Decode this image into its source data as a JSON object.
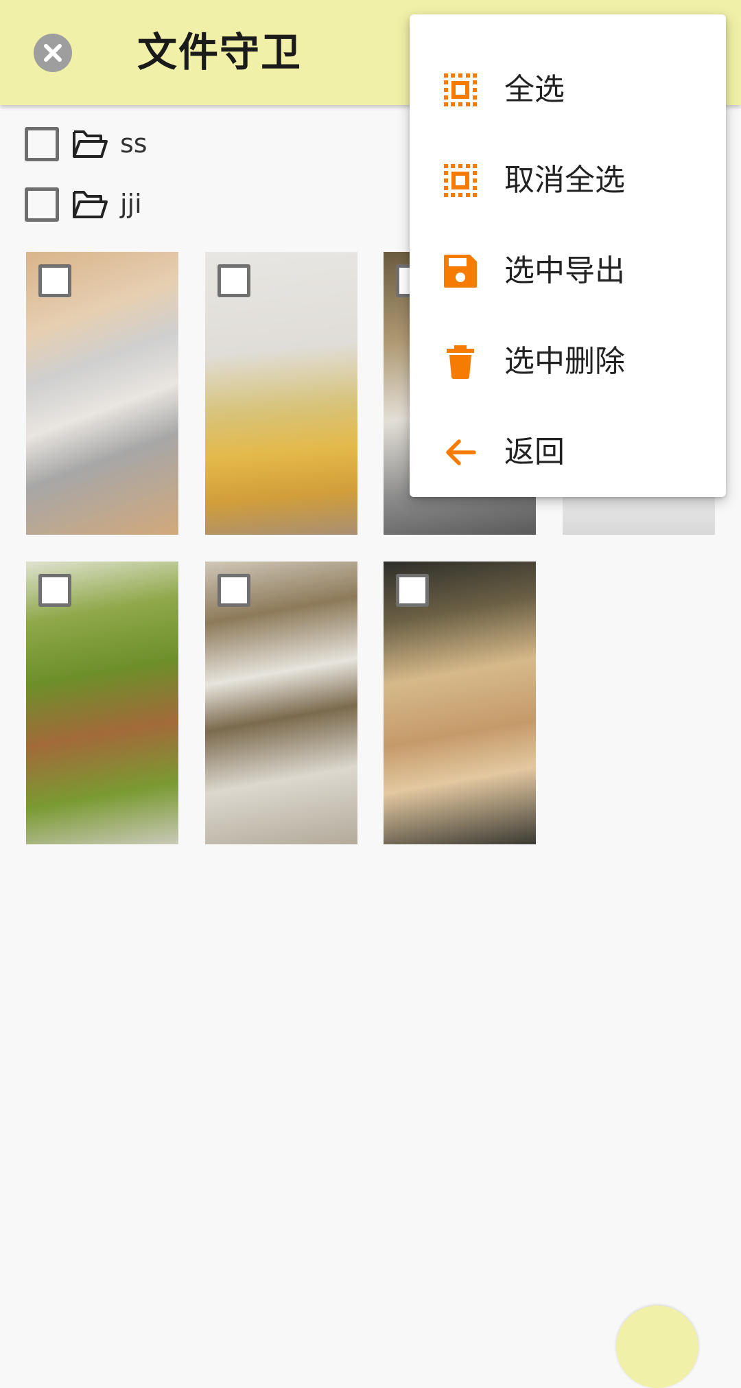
{
  "app_bar": {
    "title": "文件守卫",
    "close_icon": "close-circle-icon",
    "background": "#f0f0a8"
  },
  "folders": [
    {
      "name": "ss",
      "checked": false,
      "icon": "folder-open-icon"
    },
    {
      "name": "jji",
      "checked": false,
      "icon": "folder-open-icon"
    }
  ],
  "images": [
    {
      "subject": "cat-on-chair",
      "checked": false
    },
    {
      "subject": "cat-in-yellow-sweater",
      "checked": false
    },
    {
      "subject": "food-bag",
      "checked": false
    },
    {
      "subject": "plate",
      "checked": false
    },
    {
      "subject": "stuffed-green-peppers",
      "checked": false
    },
    {
      "subject": "grilled-oysters",
      "checked": false
    },
    {
      "subject": "stir-fried-dish",
      "checked": false
    }
  ],
  "menu": {
    "items": [
      {
        "label": "全选",
        "icon": "select-all-icon"
      },
      {
        "label": "取消全选",
        "icon": "deselect-all-icon"
      },
      {
        "label": "选中导出",
        "icon": "save-icon"
      },
      {
        "label": "选中删除",
        "icon": "delete-icon"
      },
      {
        "label": "返回",
        "icon": "arrow-back-icon"
      }
    ],
    "icon_color": "#f57c00"
  }
}
